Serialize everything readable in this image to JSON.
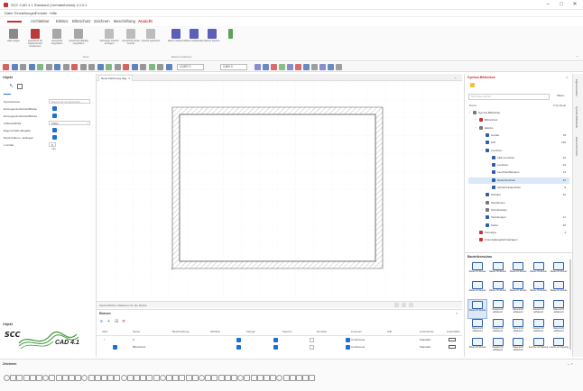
{
  "window": {
    "title": "SCC CAD 4.1 Standard (Vorhabebeistn) 4.1.0.1",
    "minimize": "–",
    "maximize": "□",
    "close": "✕"
  },
  "menu": [
    "Datei",
    "Einstellungen",
    "Fenster",
    "Hilfe"
  ],
  "ribbon_tabs": [
    "Architektur",
    "Elektro",
    "Blitzschutz",
    "Zeichnen",
    "Beschriftung",
    "Ansicht"
  ],
  "ribbon_buttons": [
    {
      "label": "Alles zeigen",
      "icon": "zoom-all-icon",
      "color": "#8a8a8a"
    },
    {
      "label": "Ausschnitt für Papierbereich bestimmen",
      "icon": "frame-icon",
      "color": "#bb3a3a"
    },
    {
      "label": "Ausschnitt vergrößern",
      "icon": "zoom-in-icon",
      "color": "#a7a7a7"
    },
    {
      "label": "Ausschnitt (fließig) vergrößern",
      "icon": "zoom-flow-icon",
      "color": "#a7a7a7"
    },
    {
      "label": "Vorheriger Ansicht anzeigen",
      "icon": "previous-view-icon",
      "color": "#bdbdbd"
    },
    {
      "label": "Ausschnitt letzter Ansicht",
      "icon": "last-view-icon",
      "color": "#bdbdbd"
    },
    {
      "label": "Ansicht speichern",
      "icon": "save-view-icon",
      "color": "#bdbdbd"
    },
    {
      "label": "Ebene isolieren",
      "icon": "layer-isolate-icon",
      "color": "#5b5fb8"
    },
    {
      "label": "Ebene ausblenden",
      "icon": "layer-hide-icon",
      "color": "#5b5fb8"
    },
    {
      "label": "Ebene sperren",
      "icon": "layer-lock-icon",
      "color": "#5b5fb8"
    },
    {
      "label": "",
      "icon": "pen-icon",
      "color": "#5aa35a"
    }
  ],
  "ribbon_groups": [
    "Zoom",
    "Ebenen Funktionen"
  ],
  "toolbar": {
    "coord1": "12,857 0",
    "coord2": "0,500 0"
  },
  "left_panel": {
    "title": "Objekt",
    "rows": [
      {
        "key": "Symbolname",
        "value": "Bauteil für Symbolinhalt …",
        "type": "text"
      },
      {
        "key": "Erzeugende Einheit/Blöcke",
        "value": "",
        "type": "check"
      },
      {
        "key": "Erzeugende Einheit/Blöcke …",
        "value": "",
        "type": "check"
      },
      {
        "key": "Füllanzahl/Stil",
        "value": "Farbe",
        "type": "select"
      },
      {
        "key": "Eigenschafts-Eingabe",
        "value": "",
        "type": "check"
      },
      {
        "key": "Rand Füllen u. Einlegen",
        "value": "",
        "type": "check"
      },
      {
        "key": "x-Größe",
        "value": "8 mm",
        "type": "text"
      }
    ]
  },
  "drawing": {
    "tab": "Neue Zeichnung.dwg"
  },
  "canvas_status": "Zeichenfläche: Markieren für die Fläche",
  "layers": {
    "title": "Ebenen",
    "columns": [
      "Aktiv",
      "Name",
      "Beschreibung",
      "Sichtbar",
      "Fangen",
      "Sperren",
      "Drucken",
      "Linienart",
      "Stift",
      "Linienbreite",
      "Linienfarbe"
    ],
    "rows": [
      {
        "name": "0",
        "linetype": "Continuous",
        "width": "Standard"
      },
      {
        "name": "Blitzschutz",
        "linetype": "Continuous",
        "width": "Standard"
      }
    ]
  },
  "symbol_panel": {
    "title": "Symbol-Bibliothek",
    "search_placeholder": "Symbole suchen …",
    "filter_label": "Filtern",
    "col_name": "Name",
    "col_count": "# Symbole",
    "tree": [
      {
        "label": "Symbol-Bibliothek",
        "indent": 0,
        "count": "",
        "color": "#777"
      },
      {
        "label": "Blitzschutz",
        "indent": 1,
        "count": "",
        "color": "#c7322e"
      },
      {
        "label": "Elektro",
        "indent": 1,
        "count": "",
        "color": "#777"
      },
      {
        "label": "Geräte",
        "indent": 2,
        "count": "18",
        "color": "#2a5ea8"
      },
      {
        "label": "HW",
        "indent": 2,
        "count": "126",
        "color": "#2a5ea8"
      },
      {
        "label": "Leuchten",
        "indent": 2,
        "count": "",
        "color": "#2a5ea8"
      },
      {
        "label": "LED-Leuchten",
        "indent": 3,
        "count": "10",
        "color": "#2a5ea8"
      },
      {
        "label": "Leuchten",
        "indent": 3,
        "count": "33",
        "color": "#2a5ea8"
      },
      {
        "label": "Leuchtstofflampen",
        "indent": 3,
        "count": "14",
        "color": "#2a5ea8"
      },
      {
        "label": "Rasterleuchten",
        "indent": 3,
        "count": "34",
        "color": "#2a5ea8"
      },
      {
        "label": "Sicherheitsleuchten",
        "indent": 3,
        "count": "9",
        "color": "#2a5ea8"
      },
      {
        "label": "Schalter",
        "indent": 2,
        "count": "46",
        "color": "#2a5ea8"
      },
      {
        "label": "Steckdosen",
        "indent": 2,
        "count": "",
        "color": "#777"
      },
      {
        "label": "Schnittstellen",
        "indent": 2,
        "count": "",
        "color": "#777"
      },
      {
        "label": "Verteilungen",
        "indent": 2,
        "count": "21",
        "color": "#2a5ea8"
      },
      {
        "label": "Kabel",
        "indent": 2,
        "count": "40",
        "color": "#2a5ea8"
      },
      {
        "label": "Sonstiges",
        "indent": 1,
        "count": "4",
        "color": "#c7322e"
      },
      {
        "label": "Potentialausgleichsanlagen",
        "indent": 1,
        "count": "",
        "color": "#c7322e"
      }
    ],
    "selected_index": 9,
    "components_title": "Bauteilvorschau",
    "components": [
      "Raster-HV Einbau",
      "Raster-HV Einbau",
      "Raster-HV Einbau",
      "Raster-HV Einbau",
      "Raster-HV Einbau",
      "Raster-HV Einbau",
      "Raster-HV Einbau",
      "Raster-HV Einbau",
      "Raster-HV Einbau",
      "Raster-HV Einbau",
      "Raster-HV Einbau",
      "Rasterprofil aufbauend",
      "Rasterprofil aufbauend",
      "Rasterprofil aufbauend",
      "Rasterprofil aufbauend",
      "Rasterprofil aufbauend",
      "Rasterprofil aufbauend",
      "Rasterprofil aufbauend",
      "Rasterprofil aufbauend",
      "Rasterprofil aufbauend",
      "Raster-HV Einbau",
      "Rasterprofil aufbauend",
      "Rasterprofil aufbauend",
      "Leuchte mit Fassung",
      "Leuchte mit Fassung"
    ]
  },
  "side_tabs": [
    "Eigenschaften",
    "Symbol-Bibliothek",
    "Ebenen/Ansicht"
  ],
  "logo": {
    "brand": "SCC",
    "product": "CAD 4.1"
  },
  "zeichnen_title": "Zeichnen",
  "panel_objekt2": "Objekt",
  "colors": {
    "accent": "#c7322e",
    "blue": "#1f6fd1",
    "logo_green": "#3a9a3a"
  }
}
